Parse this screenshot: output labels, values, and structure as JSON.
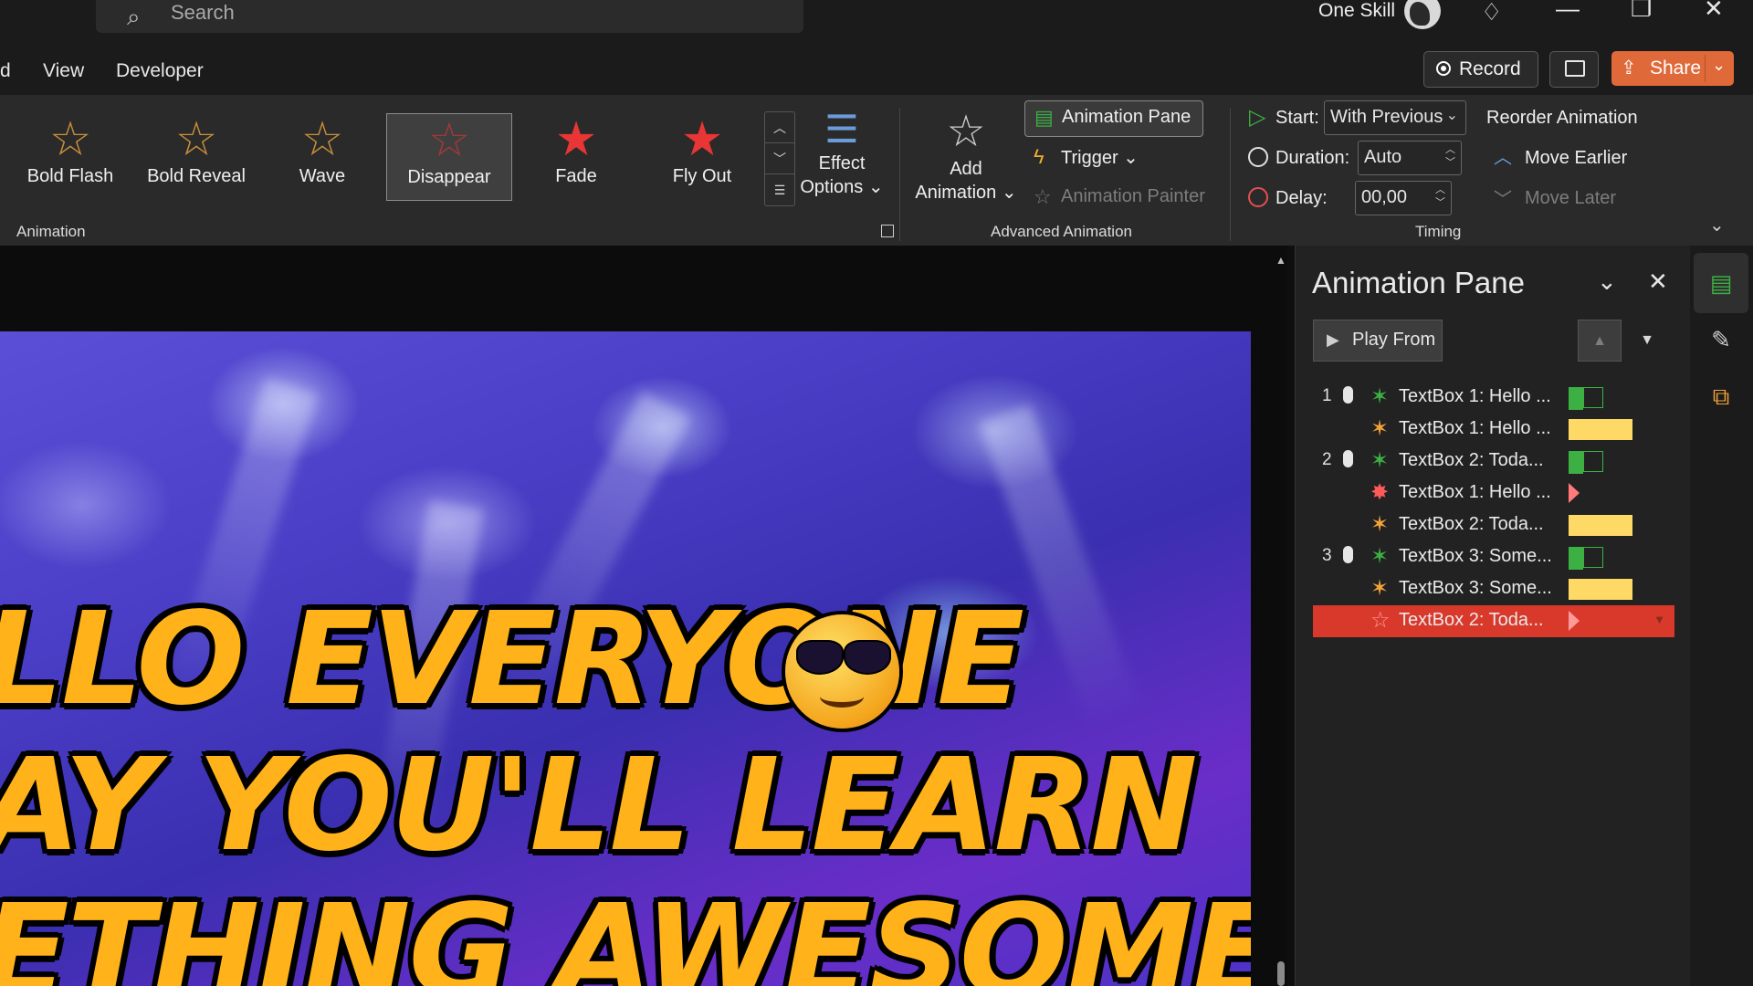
{
  "titlebar": {
    "search_placeholder": "Search",
    "user_name": "One Skill",
    "minimize": "—",
    "restore": "❐",
    "close": "✕"
  },
  "menu": {
    "partial_tab": "d",
    "view": "View",
    "developer": "Developer",
    "record": "Record",
    "share": "Share"
  },
  "ribbon": {
    "gallery": [
      {
        "label": "Bold Flash",
        "icon": "bold-flash-star-icon"
      },
      {
        "label": "Bold Reveal",
        "icon": "bold-reveal-star-icon"
      },
      {
        "label": "Wave",
        "icon": "wave-star-icon"
      },
      {
        "label": "Disappear",
        "icon": "disappear-star-icon",
        "selected": true
      },
      {
        "label": "Fade",
        "icon": "fade-star-icon"
      },
      {
        "label": "Fly Out",
        "icon": "fly-out-star-icon"
      }
    ],
    "effect_options": "Effect Options",
    "effect_options_line1": "Effect",
    "effect_options_line2": "Options",
    "animation_group": "Animation",
    "add_animation_line1": "Add",
    "add_animation_line2": "Animation",
    "animation_pane": "Animation Pane",
    "trigger": "Trigger",
    "animation_painter": "Animation Painter",
    "advanced_group": "Advanced Animation",
    "start_label": "Start:",
    "start_value": "With Previous",
    "duration_label": "Duration:",
    "duration_value": "Auto",
    "delay_label": "Delay:",
    "delay_value": "00,00",
    "timing_group": "Timing",
    "reorder_title": "Reorder Animation",
    "move_earlier": "Move Earlier",
    "move_later": "Move Later"
  },
  "slide": {
    "line1": "LLO EVERYONE",
    "line2": "AY YOU'LL LEARN",
    "line3": "ETHING AWESOME"
  },
  "pane": {
    "title": "Animation Pane",
    "play_from": "Play From",
    "items": [
      {
        "number": "1",
        "trigger": "click",
        "effect": "entrance",
        "label": "TextBox 1: Hello ...",
        "bar": "green"
      },
      {
        "number": "",
        "trigger": "",
        "effect": "emphasis",
        "label": "TextBox 1: Hello ...",
        "bar": "yellow"
      },
      {
        "number": "2",
        "trigger": "click",
        "effect": "entrance",
        "label": "TextBox 2: Toda...",
        "bar": "green"
      },
      {
        "number": "",
        "trigger": "",
        "effect": "exit",
        "label": "TextBox 1: Hello ...",
        "bar": "red-triangle"
      },
      {
        "number": "",
        "trigger": "",
        "effect": "emphasis",
        "label": "TextBox 2: Toda...",
        "bar": "yellow"
      },
      {
        "number": "3",
        "trigger": "click",
        "effect": "entrance",
        "label": "TextBox 3: Some...",
        "bar": "green"
      },
      {
        "number": "",
        "trigger": "",
        "effect": "emphasis",
        "label": "TextBox 3: Some...",
        "bar": "yellow"
      },
      {
        "number": "",
        "trigger": "",
        "effect": "exit",
        "label": "TextBox 2: Toda...",
        "bar": "red-triangle",
        "selected": true
      }
    ]
  },
  "colors": {
    "accent_share": "#e0693a",
    "selected_row": "#d9392b",
    "entrance_green": "#3cb043",
    "emphasis_yellow": "#ffd966",
    "exit_red": "#ff6b6b"
  }
}
